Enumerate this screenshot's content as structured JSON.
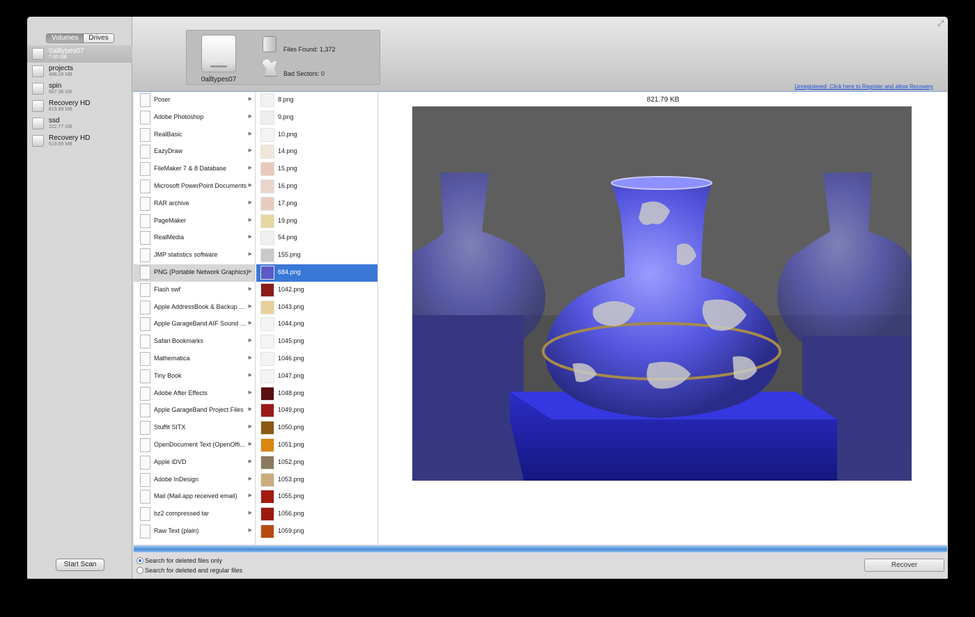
{
  "sidebar": {
    "tabs": [
      "Volumes",
      "Drives"
    ],
    "volumes": [
      {
        "name": "0alltypes07",
        "size": "7.00 GB"
      },
      {
        "name": "projects",
        "size": "488.28 MB"
      },
      {
        "name": "spin",
        "size": "687.36 GB"
      },
      {
        "name": "Recovery HD",
        "size": "619.89 MB"
      },
      {
        "name": "ssd",
        "size": "222.77 GB"
      },
      {
        "name": "Recovery HD",
        "size": "619.89 MB"
      }
    ],
    "start_scan": "Start Scan"
  },
  "info": {
    "drive_label": "0alltypes07",
    "files_found": "Files Found:  1,372",
    "bad_sectors": "Bad Sectors:  0"
  },
  "register_link": "Unregistered: Click here to Register and allow Recovery",
  "categories": [
    "Poser",
    "Adobe Photoshop",
    "RealBasic",
    "EazyDraw",
    "FileMaker 7 & 8 Database",
    "Microsoft PowerPoint Documents",
    "RAR archive",
    "PageMaker",
    "RealMedia",
    "JMP statistics software",
    "PNG (Portable Network Graphics)",
    "Flash swf",
    "Apple AddressBook & Backup Files",
    "Apple GarageBand AIF Sound Files",
    "Safari Bookmarks",
    "Mathematica",
    "Tiny Book",
    "Adobe After Effects",
    "Apple GarageBand Project Files",
    "Stuffit SITX",
    "OpenDocument Text (OpenOffi...",
    "Apple iDVD",
    "Adobe InDesign",
    "Mail (Mail.app received email)",
    "bz2 compressed tar",
    "Raw Text (plain)"
  ],
  "files": [
    "8.png",
    "9.png",
    "10.png",
    "14.png",
    "15.png",
    "16.png",
    "17.png",
    "19.png",
    "54.png",
    "155.png",
    "684.png",
    "1042.png",
    "1043.png",
    "1044.png",
    "1045.png",
    "1046.png",
    "1047.png",
    "1048.png",
    "1049.png",
    "1050.png",
    "1051.png",
    "1052.png",
    "1053.png",
    "1055.png",
    "1056.png",
    "1059.png"
  ],
  "preview": {
    "size": "821.79 KB"
  },
  "options": {
    "deleted_only": "Search for deleted files only",
    "deleted_and_regular": "Search for deleted and regular files"
  },
  "recover": "Recover"
}
